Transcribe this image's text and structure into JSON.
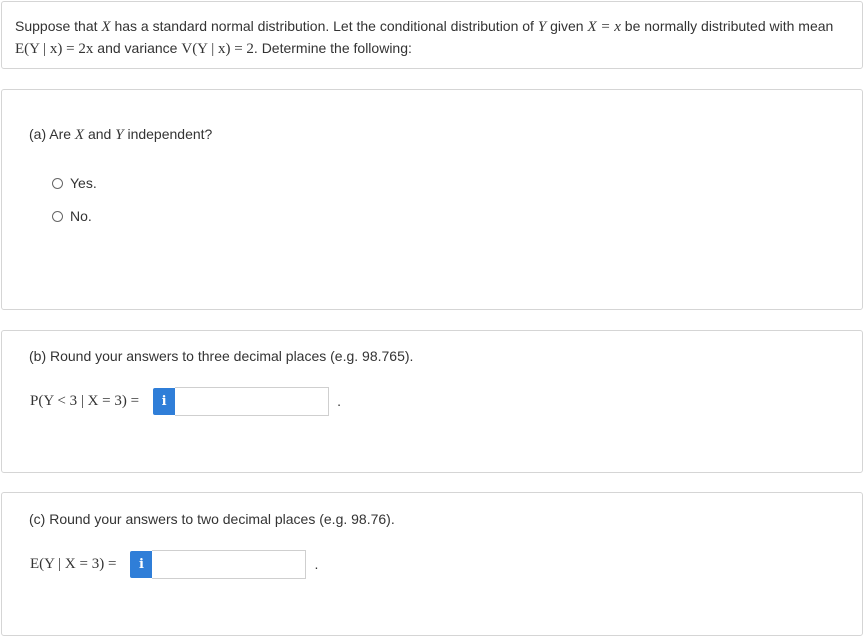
{
  "intro": {
    "t1": "Suppose that ",
    "x1": "X",
    "t2": " has a standard normal distribution. Let the conditional distribution of ",
    "y1": "Y",
    "t3": " given ",
    "cond": "X = x",
    "t4": " be normally distributed with mean ",
    "mean_expr": "E(Y | x) = 2x",
    "t5": " and variance ",
    "var_expr": "V(Y | x) = 2",
    "t6": ". Determine the following:"
  },
  "part_a": {
    "prefix": "(a) Are ",
    "x": "X",
    "mid": " and ",
    "y": "Y",
    "suffix": " independent?",
    "options": [
      "Yes.",
      "No."
    ]
  },
  "part_b": {
    "instruction": "(b) Round your answers to three decimal places (e.g. 98.765).",
    "expression": "P(Y < 3 | X = 3) =",
    "info_label": "i",
    "answer_value": "",
    "trailing": "."
  },
  "part_c": {
    "instruction": "(c) Round your answers to two decimal places (e.g. 98.76).",
    "expression": "E(Y | X = 3) =",
    "info_label": "i",
    "answer_value": "",
    "trailing": "."
  }
}
